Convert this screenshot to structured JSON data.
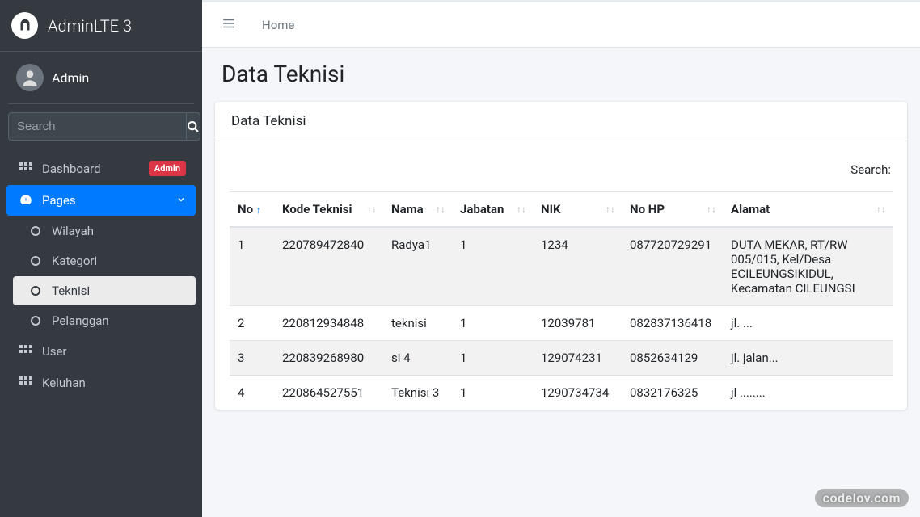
{
  "brand": {
    "title": "AdminLTE 3"
  },
  "user": {
    "name": "Admin"
  },
  "search": {
    "placeholder": "Search"
  },
  "nav": {
    "dashboard": {
      "label": "Dashboard",
      "badge": "Admin"
    },
    "pages": {
      "label": "Pages",
      "children": {
        "wilayah": "Wilayah",
        "kategori": "Kategori",
        "teknisi": "Teknisi",
        "pelanggan": "Pelanggan"
      }
    },
    "user_menu": "User",
    "keluhan": "Keluhan"
  },
  "breadcrumb": {
    "home": "Home"
  },
  "page": {
    "title": "Data Teknisi"
  },
  "card": {
    "title": "Data Teknisi"
  },
  "datatable": {
    "search_label": "Search:",
    "headers": {
      "no": "No",
      "kode": "Kode Teknisi",
      "nama": "Nama",
      "jabatan": "Jabatan",
      "nik": "NIK",
      "nohp": "No HP",
      "alamat": "Alamat"
    },
    "rows": [
      {
        "no": "1",
        "kode": "220789472840",
        "nama": "Radya1",
        "jabatan": "1",
        "nik": "1234",
        "nohp": "087720729291",
        "alamat": "DUTA MEKAR, RT/RW 005/015, Kel/Desa ECILEUNGSIKIDUL, Kecamatan CILEUNGSI"
      },
      {
        "no": "2",
        "kode": "220812934848",
        "nama": "teknisi",
        "jabatan": "1",
        "nik": "12039781",
        "nohp": "082837136418",
        "alamat": "jl. ..."
      },
      {
        "no": "3",
        "kode": "220839268980",
        "nama": "si 4",
        "jabatan": "1",
        "nik": "129074231",
        "nohp": "0852634129",
        "alamat": "jl. jalan..."
      },
      {
        "no": "4",
        "kode": "220864527551",
        "nama": "Teknisi 3",
        "jabatan": "1",
        "nik": "1290734734",
        "nohp": "0832176325",
        "alamat": "jl ........"
      }
    ]
  },
  "watermark": "codelov.com"
}
